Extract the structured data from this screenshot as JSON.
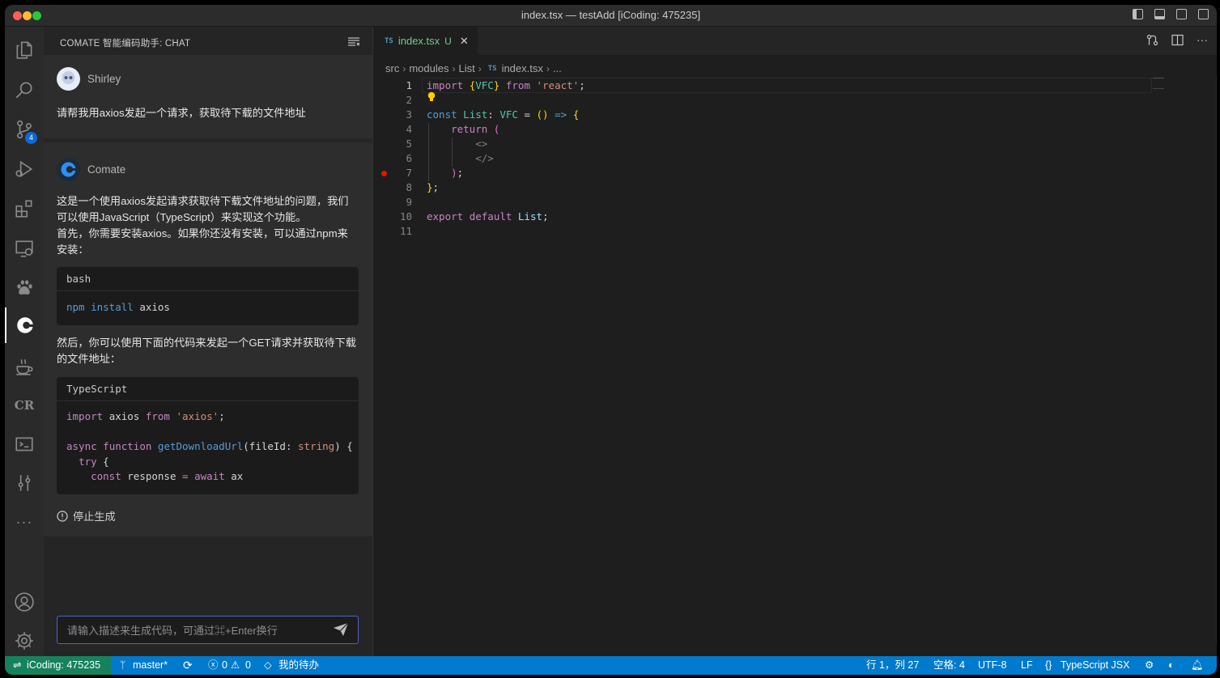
{
  "window": {
    "title": "index.tsx — testAdd [iCoding: 475235]"
  },
  "activity_bar": {
    "items": [
      {
        "icon": "files-icon"
      },
      {
        "icon": "search-icon"
      },
      {
        "icon": "source-control-icon",
        "badge": "4"
      },
      {
        "icon": "run-debug-icon"
      },
      {
        "icon": "extensions-icon"
      },
      {
        "icon": "remote-explorer-icon"
      },
      {
        "icon": "paw-icon"
      },
      {
        "icon": "comate-icon",
        "active": true
      },
      {
        "icon": "coffee-icon"
      },
      {
        "icon": "cr-icon",
        "label": "CR"
      },
      {
        "icon": "terminal-icon"
      },
      {
        "icon": "sliders-icon"
      },
      {
        "icon": "more-icon",
        "label": "···"
      }
    ],
    "bottom": [
      {
        "icon": "account-icon"
      },
      {
        "icon": "settings-gear-icon"
      }
    ]
  },
  "sidebar": {
    "title": "COMATE 智能编码助手: CHAT",
    "user_message": {
      "name": "Shirley",
      "text": "请帮我用axios发起一个请求，获取待下载的文件地址"
    },
    "bot_message": {
      "name": "Comate",
      "intro": "这是一个使用axios发起请求获取待下载文件地址的问题，我们可以使用JavaScript（TypeScript）来实现这个功能。",
      "install_note": "首先，你需要安装axios。如果你还没有安装，可以通过npm来安装：",
      "code1": {
        "lang": "bash",
        "cmd": "npm",
        "sub": "install",
        "arg": "axios"
      },
      "then": "然后，你可以使用下面的代码来发起一个GET请求并获取待下载的文件地址：",
      "code2": {
        "lang": "TypeScript",
        "t_import": "import",
        "t_axios": "axios",
        "t_from": "from",
        "t_mod": "'axios'",
        "t_semi": ";",
        "t_async": "async",
        "t_function": "function",
        "t_fn": "getDownloadUrl",
        "t_paren": "(fileId:",
        "t_type": "string",
        "t_close": ") {",
        "t_try": "try",
        "t_brace": " {",
        "t_const": "const",
        "t_resp": "response",
        "t_eq": "=",
        "t_await": "await",
        "t_ax": "ax"
      }
    },
    "stop_label": "停止生成",
    "input_placeholder": "请输入描述来生成代码，可通过⌘+Enter换行"
  },
  "editor": {
    "tab": {
      "badge": "TS",
      "name": "index.tsx",
      "status": "U"
    },
    "breadcrumb": [
      "src",
      "modules",
      "List",
      "index.tsx",
      "..."
    ],
    "line_numbers": [
      "1",
      "2",
      "3",
      "4",
      "5",
      "6",
      "7",
      "8",
      "9",
      "10",
      "11"
    ],
    "code": {
      "l1_import": "import",
      "l1_open": "{",
      "l1_vfc": "VFC",
      "l1_close": "}",
      "l1_from": "from",
      "l1_str": "'react'",
      "l1_semi": ";",
      "l3_const": "const",
      "l3_list": "List",
      "l3_colon": ":",
      "l3_vfc": "VFC",
      "l3_eq": "=",
      "l3_parens": "()",
      "l3_arrow": "=>",
      "l3_brace": "{",
      "l4_return": "return",
      "l4_paren": "(",
      "l5_frag": "<>",
      "l6_frag": "</>",
      "l7_paren": ")",
      "l7_semi": ";",
      "l8_brace": "}",
      "l8_semi": ";",
      "l10_export": "export",
      "l10_default": "default",
      "l10_list": "List",
      "l10_semi": ";"
    }
  },
  "statusbar": {
    "remote": "iCoding: 475235",
    "branch": "master*",
    "errors": "0",
    "warnings": "0",
    "todo": "我的待办",
    "position": "行 1，列 27",
    "spaces": "空格: 4",
    "encoding": "UTF-8",
    "eol": "LF",
    "language": "TypeScript JSX"
  },
  "colors": {
    "statusbar": "#007acc",
    "remote": "#16825d",
    "accent_input": "#4a63c7"
  }
}
